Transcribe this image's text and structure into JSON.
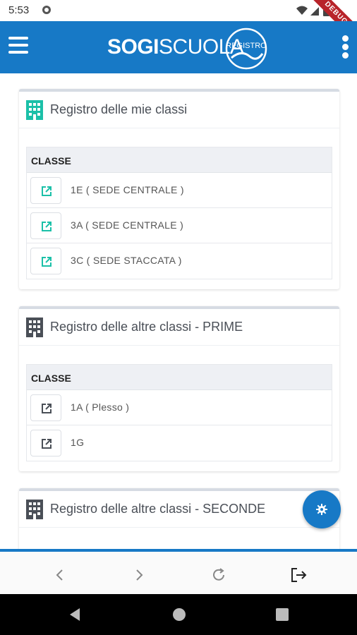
{
  "status_bar": {
    "time": "5:53",
    "debug_label": "DEBUG"
  },
  "app_bar": {
    "logo_bold": "SOGI",
    "logo_light": "SCUOLA",
    "badge_text": "REGISTRO"
  },
  "cards": [
    {
      "title": "Registro delle mie classi",
      "icon_color": "#1bc0a8",
      "column_header": "CLASSE",
      "rows": [
        "1E ( SEDE CENTRALE )",
        "3A ( SEDE CENTRALE )",
        "3C ( SEDE STACCATA )"
      ]
    },
    {
      "title": "Registro delle altre classi - PRIME",
      "icon_color": "#4a4f57",
      "column_header": "CLASSE",
      "rows": [
        "1A ( Plesso )",
        "1G"
      ]
    },
    {
      "title": "Registro delle altre classi - SECONDE",
      "icon_color": "#4a4f57",
      "column_header": "",
      "rows": []
    }
  ],
  "colors": {
    "primary": "#1779c6",
    "accent": "#1bc0a8",
    "text": "#4a4f57"
  },
  "icons": {
    "menu": "hamburger-icon",
    "more": "more-vert-icon",
    "building": "building-icon",
    "open": "open-external-icon",
    "settings": "gear-icon",
    "back": "chevron-left-icon",
    "forward": "chevron-right-icon",
    "refresh": "refresh-icon",
    "logout": "logout-icon"
  }
}
